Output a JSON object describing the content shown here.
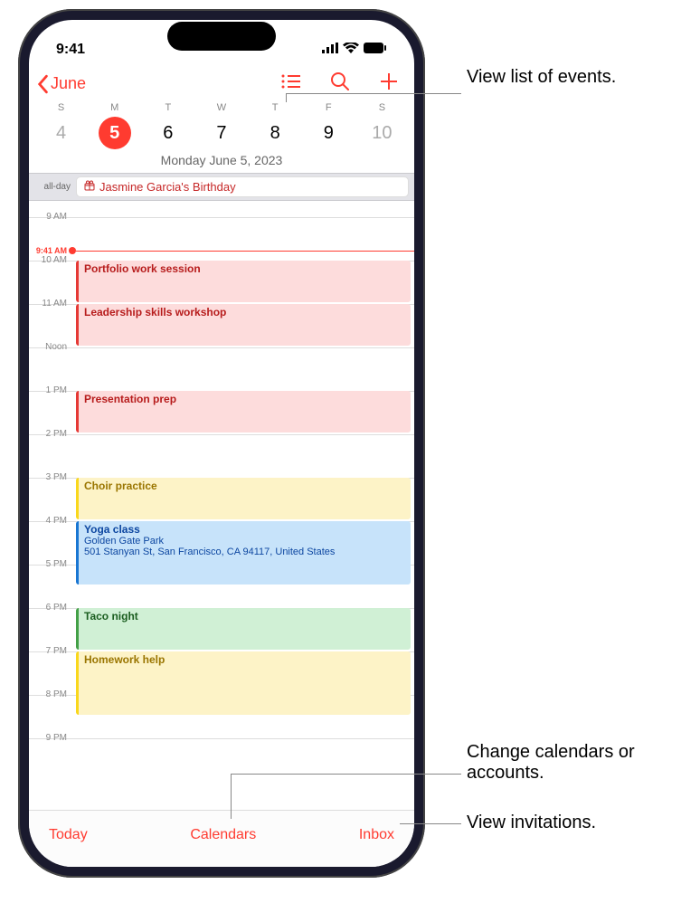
{
  "status": {
    "time": "9:41"
  },
  "header": {
    "back": "June"
  },
  "week": {
    "letters": [
      "S",
      "M",
      "T",
      "W",
      "T",
      "F",
      "S"
    ],
    "days": [
      "4",
      "5",
      "6",
      "7",
      "8",
      "9",
      "10"
    ],
    "selected_index": 1
  },
  "date_label": "Monday   June 5, 2023",
  "allday": {
    "label": "all-day",
    "event": "Jasmine Garcia's Birthday"
  },
  "hours": [
    "9 AM",
    "10 AM",
    "11 AM",
    "Noon",
    "1 PM",
    "2 PM",
    "3 PM",
    "4 PM",
    "5 PM",
    "6 PM",
    "7 PM",
    "8 PM",
    "9 PM"
  ],
  "now_label": "9:41 AM",
  "events": {
    "portfolio": "Portfolio work session",
    "leadership": "Leadership skills workshop",
    "presentation": "Presentation prep",
    "choir": "Choir practice",
    "yoga_title": "Yoga class",
    "yoga_loc1": "Golden Gate Park",
    "yoga_loc2": "501 Stanyan St, San Francisco, CA 94117, United States",
    "taco": "Taco night",
    "homework": "Homework help"
  },
  "bottom": {
    "today": "Today",
    "calendars": "Calendars",
    "inbox": "Inbox"
  },
  "callouts": {
    "list": "View list of events.",
    "calendars": "Change calendars or accounts.",
    "inbox": "View invitations."
  }
}
